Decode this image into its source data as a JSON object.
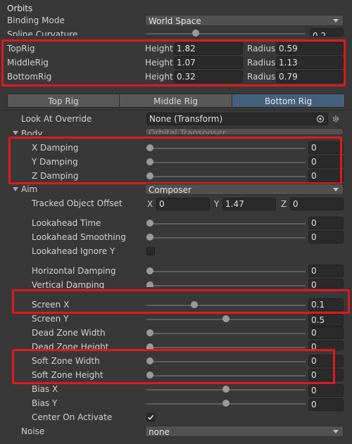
{
  "header": {
    "title": "Orbits"
  },
  "binding_mode": {
    "label": "Binding Mode",
    "value": "World Space"
  },
  "spline_curvature": {
    "label": "Spline Curvature",
    "value": "0.2",
    "fraction": 0.3
  },
  "rigs": [
    {
      "name": "TopRig",
      "height_label": "Height",
      "height": "1.82",
      "radius_label": "Radius",
      "radius": "0.59"
    },
    {
      "name": "MiddleRig",
      "height_label": "Height",
      "height": "1.07",
      "radius_label": "Radius",
      "radius": "1.13"
    },
    {
      "name": "BottomRig",
      "height_label": "Height",
      "height": "0.32",
      "radius_label": "Radius",
      "radius": "0.79"
    }
  ],
  "tabs": [
    {
      "label": "Top Rig",
      "active": false
    },
    {
      "label": "Middle Rig",
      "active": false
    },
    {
      "label": "Bottom Rig",
      "active": true
    }
  ],
  "look_at": {
    "label": "Look At Override",
    "value": "None (Transform)"
  },
  "body": {
    "label": "Body",
    "value": "Orbital Transposer",
    "x_damping": {
      "label": "X Damping",
      "value": "0",
      "fraction": 0
    },
    "y_damping": {
      "label": "Y Damping",
      "value": "0",
      "fraction": 0
    },
    "z_damping": {
      "label": "Z Damping",
      "value": "0",
      "fraction": 0
    }
  },
  "aim": {
    "label": "Aim",
    "value": "Composer",
    "tracked_offset": {
      "label": "Tracked Object Offset",
      "x_label": "X",
      "x": "0",
      "y_label": "Y",
      "y": "1.47",
      "z_label": "Z",
      "z": "0"
    },
    "lookahead_time": {
      "label": "Lookahead Time",
      "value": "0",
      "fraction": 0
    },
    "lookahead_smoothing": {
      "label": "Lookahead Smoothing",
      "value": "0",
      "fraction": 0
    },
    "lookahead_ignore_y": {
      "label": "Lookahead Ignore Y",
      "checked": false
    },
    "horizontal_damping": {
      "label": "Horizontal Damping",
      "value": "0",
      "fraction": 0
    },
    "vertical_damping": {
      "label": "Vertical Damping",
      "value": "0",
      "fraction": 0
    },
    "screen_x": {
      "label": "Screen X",
      "value": "0.1",
      "fraction": 0.29
    },
    "screen_y": {
      "label": "Screen Y",
      "value": "0.5",
      "fraction": 0.5
    },
    "dead_zone_width": {
      "label": "Dead Zone Width",
      "value": "0",
      "fraction": 0
    },
    "dead_zone_height": {
      "label": "Dead Zone Height",
      "value": "0",
      "fraction": 0
    },
    "soft_zone_width": {
      "label": "Soft Zone Width",
      "value": "0",
      "fraction": 0
    },
    "soft_zone_height": {
      "label": "Soft Zone Height",
      "value": "0",
      "fraction": 0
    },
    "bias_x": {
      "label": "Bias X",
      "value": "0",
      "fraction": 0.5
    },
    "bias_y": {
      "label": "Bias Y",
      "value": "0",
      "fraction": 0.5
    },
    "center_on_activate": {
      "label": "Center On Activate",
      "checked": true
    }
  },
  "noise": {
    "label": "Noise",
    "value": "none"
  },
  "colors": {
    "highlight": "#e0191f",
    "active_tab": "#46607c",
    "background": "#383838"
  }
}
